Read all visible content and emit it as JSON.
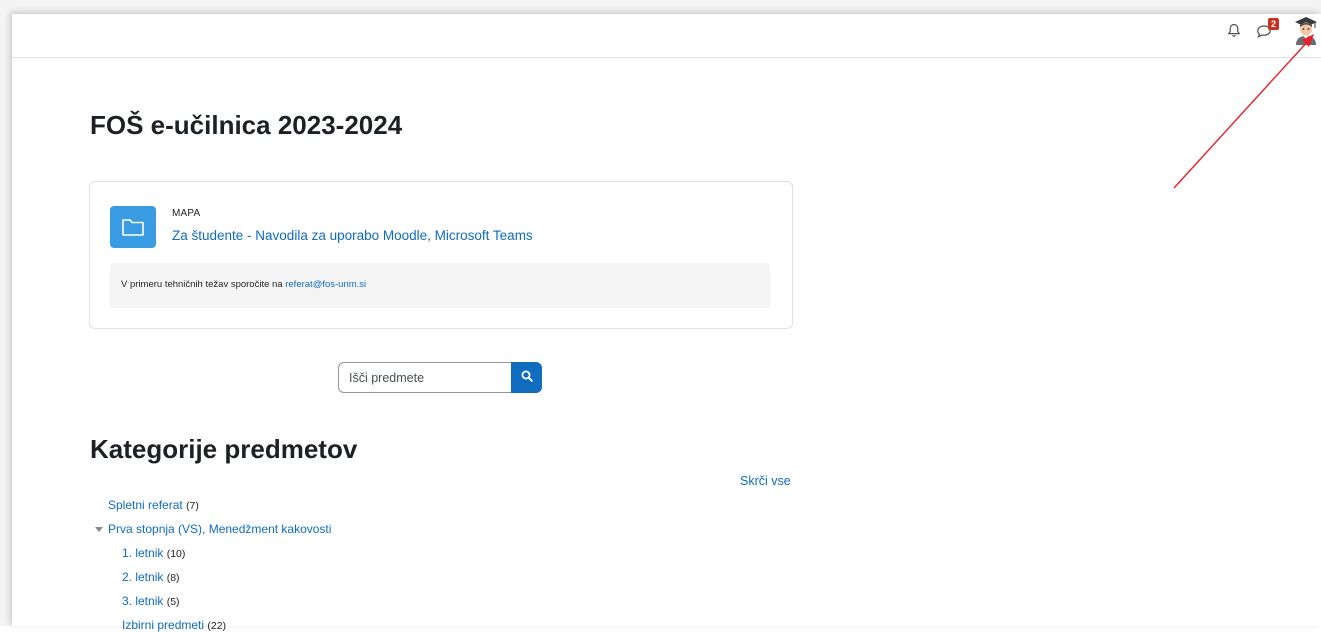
{
  "header": {
    "notifications_icon": "bell-icon",
    "messages_icon": "chat-icon",
    "message_count": "2",
    "user_menu_icon": "student-avatar-icon"
  },
  "page": {
    "title": "FOŠ e-učilnica 2023-2024"
  },
  "card": {
    "module_type": "MAPA",
    "module_link": "Za študente - Navodila za uporabo Moodle, Microsoft Teams",
    "note_text": "V primeru tehničnih težav sporočite na ",
    "note_email": "referat@fos-unm.si"
  },
  "search": {
    "placeholder": "Išči predmete"
  },
  "categories": {
    "title": "Kategorije predmetov",
    "collapse_all": "Skrči vse",
    "items": [
      {
        "label": "Spletni referat",
        "count": "(7)"
      },
      {
        "label": "Prva stopnja (VS), Menedžment kakovosti",
        "count": ""
      },
      {
        "label": "1. letnik",
        "count": "(10)"
      },
      {
        "label": "2. letnik",
        "count": "(8)"
      },
      {
        "label": "3. letnik",
        "count": "(5)"
      },
      {
        "label": "Izbirni predmeti",
        "count": "(22)"
      }
    ]
  },
  "colors": {
    "link": "#0f6cbf",
    "folder_icon_bg": "#399be2",
    "badge": "#ca3120",
    "annotation_arrow": "#e8202a"
  }
}
